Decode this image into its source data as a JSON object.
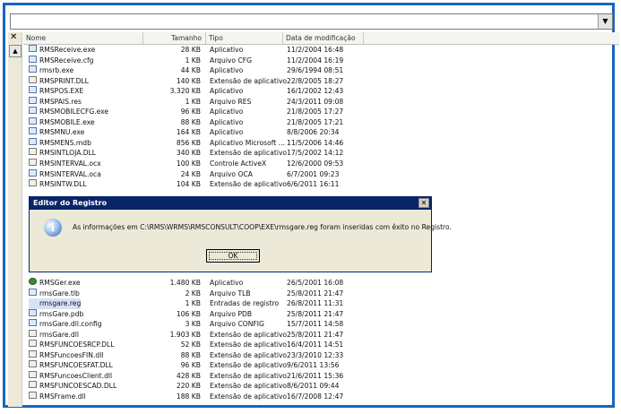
{
  "columns": {
    "name": "Nome",
    "size": "Tamanho",
    "type": "Tipo",
    "date": "Data de modificação"
  },
  "files_top": [
    {
      "name": "RMSReceive.exe",
      "size": "28 KB",
      "type": "Aplicativo",
      "date": "11/2/2004 16:48",
      "icon": "exe"
    },
    {
      "name": "RMSReceive.cfg",
      "size": "1 KB",
      "type": "Arquivo CFG",
      "date": "11/2/2004 16:19",
      "icon": "file"
    },
    {
      "name": "rmsrb.exe",
      "size": "44 KB",
      "type": "Aplicativo",
      "date": "29/6/1994 08:51",
      "icon": "exe"
    },
    {
      "name": "RMSPRINT.DLL",
      "size": "140 KB",
      "type": "Extensão de aplicativo",
      "date": "22/8/2005 18:27",
      "icon": "dll"
    },
    {
      "name": "RMSPOS.EXE",
      "size": "3.320 KB",
      "type": "Aplicativo",
      "date": "16/1/2002 12:43",
      "icon": "exe"
    },
    {
      "name": "RMSPAIS.res",
      "size": "1 KB",
      "type": "Arquivo RES",
      "date": "24/3/2011 09:08",
      "icon": "file"
    },
    {
      "name": "RMSMOBILECFG.exe",
      "size": "96 KB",
      "type": "Aplicativo",
      "date": "21/8/2005 17:27",
      "icon": "exe"
    },
    {
      "name": "RMSMOBILE.exe",
      "size": "88 KB",
      "type": "Aplicativo",
      "date": "21/8/2005 17:21",
      "icon": "exe"
    },
    {
      "name": "RMSMNU.exe",
      "size": "164 KB",
      "type": "Aplicativo",
      "date": "8/8/2006 20:34",
      "icon": "exe"
    },
    {
      "name": "RMSMENS.mdb",
      "size": "856 KB",
      "type": "Aplicativo Microsoft ...",
      "date": "11/5/2006 14:46",
      "icon": "file"
    },
    {
      "name": "RMSINTLOJA.DLL",
      "size": "340 KB",
      "type": "Extensão de aplicativo",
      "date": "17/5/2002 14:12",
      "icon": "dll"
    },
    {
      "name": "RMSINTERVAL.ocx",
      "size": "100 KB",
      "type": "Controle ActiveX",
      "date": "12/6/2000 09:53",
      "icon": "dll"
    },
    {
      "name": "RMSINTERVAL.oca",
      "size": "24 KB",
      "type": "Arquivo OCA",
      "date": "6/7/2001 09:23",
      "icon": "file"
    },
    {
      "name": "RMSINTW.DLL",
      "size": "104 KB",
      "type": "Extensão de aplicativo",
      "date": "6/6/2011 16:11",
      "icon": "dll"
    }
  ],
  "files_bottom": [
    {
      "name": "RMSGer.exe",
      "size": "1.480 KB",
      "type": "Aplicativo",
      "date": "26/5/2001 16:08",
      "icon": "globe"
    },
    {
      "name": "rmsGare.tlb",
      "size": "2 KB",
      "type": "Arquivo TLB",
      "date": "25/8/2011 21:47",
      "icon": "file"
    },
    {
      "name": "rmsgare.reg",
      "size": "1 KB",
      "type": "Entradas de registro",
      "date": "26/8/2011 11:31",
      "icon": "reg"
    },
    {
      "name": "rmsGare.pdb",
      "size": "106 KB",
      "type": "Arquivo PDB",
      "date": "25/8/2011 21:47",
      "icon": "file"
    },
    {
      "name": "rmsGare.dll.config",
      "size": "3 KB",
      "type": "Arquivo CONFIG",
      "date": "15/7/2011 14:58",
      "icon": "file"
    },
    {
      "name": "rmsGare.dll",
      "size": "1.903 KB",
      "type": "Extensão de aplicativo",
      "date": "25/8/2011 21:47",
      "icon": "dll"
    },
    {
      "name": "RMSFUNCOESRCP.DLL",
      "size": "52 KB",
      "type": "Extensão de aplicativo",
      "date": "16/4/2011 14:51",
      "icon": "dll"
    },
    {
      "name": "RMSFuncoesFIN.dll",
      "size": "88 KB",
      "type": "Extensão de aplicativo",
      "date": "23/3/2010 12:33",
      "icon": "dll"
    },
    {
      "name": "RMSFUNCOESFAT.DLL",
      "size": "96 KB",
      "type": "Extensão de aplicativo",
      "date": "9/6/2011 13:56",
      "icon": "dll"
    },
    {
      "name": "RMSFuncoesClient.dll",
      "size": "428 KB",
      "type": "Extensão de aplicativo",
      "date": "21/6/2011 15:36",
      "icon": "dll"
    },
    {
      "name": "RMSFUNCOESCAD.DLL",
      "size": "220 KB",
      "type": "Extensão de aplicativo",
      "date": "8/6/2011 09:44",
      "icon": "dll"
    },
    {
      "name": "RMSFrame.dll",
      "size": "188 KB",
      "type": "Extensão de aplicativo",
      "date": "16/7/2008 12:47",
      "icon": "dll"
    }
  ],
  "dialog": {
    "title": "Editor do Registro",
    "message": "As informações em C:\\RMS\\WRMS\\RMSCONSULT\\COOP\\EXE\\rmsgare.reg foram inseridas com êxito no Registro.",
    "ok_label": "OK"
  }
}
